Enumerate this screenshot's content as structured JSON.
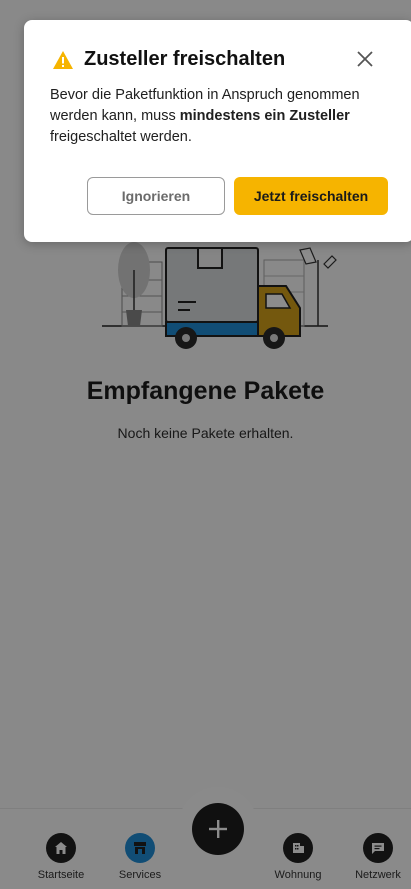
{
  "dialog": {
    "title": "Zusteller freischalten",
    "body_part1": "Bevor die Paketfunktion in Anspruch genommen werden kann, muss ",
    "body_bold": "mindestens ein Zusteller",
    "body_part2": " freigeschaltet werden.",
    "ignore_label": "Ignorieren",
    "unlock_label": "Jetzt freischalten",
    "warning_color": "#f6b400"
  },
  "main": {
    "title": "Empfangene Pakete",
    "subtitle": "Noch keine Pakete erhalten."
  },
  "nav": {
    "items": [
      {
        "label": "Startseite",
        "icon": "home-icon"
      },
      {
        "label": "Services",
        "icon": "store-icon",
        "active": true
      },
      {
        "label": "",
        "icon": "plus-icon"
      },
      {
        "label": "Wohnung",
        "icon": "building-icon"
      },
      {
        "label": "Netzwerk",
        "icon": "chat-icon"
      }
    ],
    "active_color": "#1f8dd6"
  }
}
